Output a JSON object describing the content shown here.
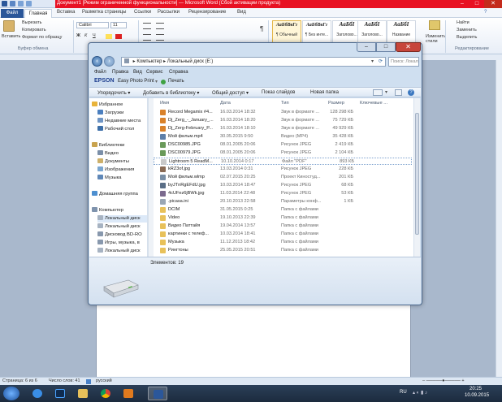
{
  "word": {
    "title": "Документ1 [Режим ограниченной функциональности] — Microsoft Word (Сбой активации продукта)",
    "tabs": [
      "Файл",
      "Главная",
      "Вставка",
      "Разметка страницы",
      "Ссылки",
      "Рассылки",
      "Рецензирование",
      "Вид"
    ],
    "ribbon": {
      "paste": "Вставить",
      "cut": "Вырезать",
      "copy": "Копировать",
      "format_painter": "Формат по образцу",
      "clipboard_group": "Буфер обмена",
      "font_name": "Calibri",
      "font_size": "11",
      "styles": [
        {
          "sample": "АаБбВвГг",
          "label": "¶ Обычный"
        },
        {
          "sample": "АаБбВвГг",
          "label": "¶ Без инте..."
        },
        {
          "sample": "АаБбI",
          "label": "Заголово..."
        },
        {
          "sample": "АаБбI",
          "label": "Заголово..."
        },
        {
          "sample": "АаБбI",
          "label": "Название"
        }
      ],
      "change_styles": "Изменить стили",
      "find": "Найти",
      "replace": "Заменить",
      "select": "Выделить",
      "editing_group": "Редактирование"
    },
    "status": {
      "page": "Страница: 6 из 6",
      "words": "Число слов: 41",
      "lang": "русский"
    }
  },
  "taskbar": {
    "lang": "RU",
    "time": "20:25",
    "date": "10.09.2015"
  },
  "explorer": {
    "address": [
      "Компьютер",
      "Локальный диск (E:)"
    ],
    "search_placeholder": "Поиск: Локальный диск (E:)",
    "menu": [
      "Файл",
      "Правка",
      "Вид",
      "Сервис",
      "Справка"
    ],
    "epson": {
      "brand": "EPSON",
      "app": "Easy Photo Print",
      "print": "Печать"
    },
    "toolbar": [
      "Упорядочить ▾",
      "Добавить в библиотеку ▾",
      "Общий доступ ▾",
      "Показ слайдов",
      "Новая папка"
    ],
    "nav": [
      {
        "label": "Избранное",
        "level": 0,
        "color": "#e8b33a"
      },
      {
        "label": "Загрузки",
        "level": 1,
        "color": "#4b7fbf"
      },
      {
        "label": "Недавние места",
        "level": 1,
        "color": "#6f95c4"
      },
      {
        "label": "Рабочий стол",
        "level": 1,
        "color": "#3d6fa8"
      },
      {
        "label": "",
        "level": 1,
        "color": ""
      },
      {
        "label": "Библиотеки",
        "level": 0,
        "color": "#c9a34e"
      },
      {
        "label": "Видео",
        "level": 1,
        "color": "#7b8fa8"
      },
      {
        "label": "Документы",
        "level": 1,
        "color": "#cdb06a"
      },
      {
        "label": "Изображения",
        "level": 1,
        "color": "#7aa6d0"
      },
      {
        "label": "Музыка",
        "level": 1,
        "color": "#5f87b7"
      },
      {
        "label": "",
        "level": 1,
        "color": ""
      },
      {
        "label": "Домашняя группа",
        "level": 0,
        "color": "#4d8fd0"
      },
      {
        "label": "",
        "level": 1,
        "color": ""
      },
      {
        "label": "Компьютер",
        "level": 0,
        "color": "#7f93ad"
      },
      {
        "label": "Локальный диск",
        "level": 1,
        "color": "#a7b3c2"
      },
      {
        "label": "Локальный диск",
        "level": 1,
        "color": "#a7b3c2"
      },
      {
        "label": "Дисковод BD-RO",
        "level": 1,
        "color": "#8898ad"
      },
      {
        "label": "Игры, музыка, в",
        "level": 1,
        "color": "#8898ad"
      },
      {
        "label": "Локальный диск",
        "level": 1,
        "color": "#a7b3c2"
      }
    ],
    "columns": [
      "Имя",
      "Дата",
      "Тип",
      "Размер",
      "Ключевые ..."
    ],
    "files": [
      {
        "name": "Record Megamix #4...",
        "date": "16.03.2014 18:32",
        "type": "Звук в формате ...",
        "size": "128 298 КБ",
        "color": "#d9822b"
      },
      {
        "name": "Dj_Zerg_-_January_...",
        "date": "16.03.2014 18:20",
        "type": "Звук в формате ...",
        "size": "75 729 КБ",
        "color": "#d9822b"
      },
      {
        "name": "Dj_Zerg-February_P...",
        "date": "16.03.2014 18:10",
        "type": "Звук в формате ...",
        "size": "49 929 КБ",
        "color": "#d9822b"
      },
      {
        "name": "Мой фильм.mp4",
        "date": "30.05.2015 9:50",
        "type": "Видео (MP4)",
        "size": "35 428 КБ",
        "color": "#5d7fa9"
      },
      {
        "name": "DSC00985.JPG",
        "date": "08.01.2005 20:06",
        "type": "Рисунок JPEG",
        "size": "2 419 КБ",
        "color": "#6a9a5a"
      },
      {
        "name": "DSC00979.JPG",
        "date": "08.01.2005 20:06",
        "type": "Рисунок JPEG",
        "size": "2 104 КБ",
        "color": "#6a9a5a"
      },
      {
        "name": "Lightroom 5 ReadM...",
        "date": "10.10.2014 0:17",
        "type": "Файл \"PDF\"",
        "size": "893 КБ",
        "color": "#c9c9c9",
        "selected": true
      },
      {
        "name": "kRZ3of.jpg",
        "date": "13.03.2014 0:31",
        "type": "Рисунок JPEG",
        "size": "228 КБ",
        "color": "#8a6b55"
      },
      {
        "name": "Мой фильм.wlmp",
        "date": "02.07.2015 20:25",
        "type": "Проект Киностуд...",
        "size": "201 КБ",
        "color": "#7a8fa6"
      },
      {
        "name": "byJTnRgEFdU.jpg",
        "date": "10.03.2014 18:47",
        "type": "Рисунок JPEG",
        "size": "68 КБ",
        "color": "#5a6e86"
      },
      {
        "name": "4cUFez6jBWk.jpg",
        "date": "11.03.2014 22:48",
        "type": "Рисунок JPEG",
        "size": "53 КБ",
        "color": "#7b6a8e"
      },
      {
        "name": ".picasa.ini",
        "date": "20.10.2013 22:58",
        "type": "Параметры конф...",
        "size": "1 КБ",
        "color": "#9aa6b4"
      },
      {
        "name": "DCIM",
        "date": "31.05.2015 0:25",
        "type": "Папка с файлами",
        "size": "",
        "color": "#e8c15a"
      },
      {
        "name": "Video",
        "date": "19.10.2013 22:39",
        "type": "Папка с файлами",
        "size": "",
        "color": "#e8c15a"
      },
      {
        "name": "Видео Паттайя",
        "date": "19.04.2014 13:57",
        "type": "Папка с файлами",
        "size": "",
        "color": "#e8c15a"
      },
      {
        "name": "картинки с телеф...",
        "date": "10.03.2014 18:41",
        "type": "Папка с файлами",
        "size": "",
        "color": "#e8c15a"
      },
      {
        "name": "Музыка",
        "date": "11.12.2013 18:42",
        "type": "Папка с файлами",
        "size": "",
        "color": "#e8c15a"
      },
      {
        "name": "Рингтоны",
        "date": "25.05.2015 20:51",
        "type": "Папка с файлами",
        "size": "",
        "color": "#e8c15a"
      }
    ],
    "status": "Элементов: 19"
  }
}
